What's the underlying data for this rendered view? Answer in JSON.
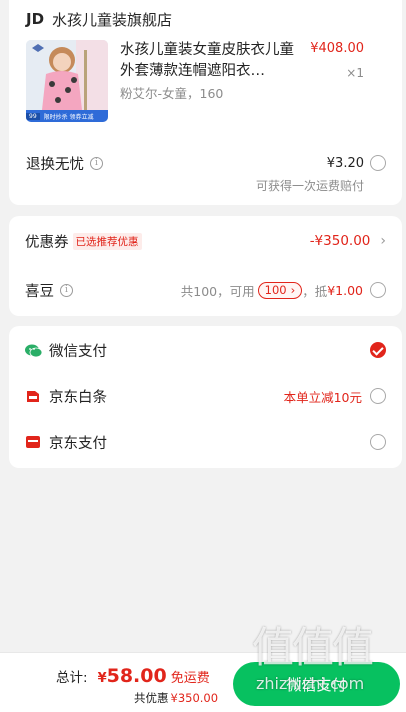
{
  "store": {
    "brand": "JD",
    "name": "水孩儿童装旗舰店"
  },
  "product": {
    "title": "水孩儿童装女童皮肤衣儿童外套薄款连帽遮阳衣…",
    "spec": "粉艾尔-女童，160",
    "price": "¥408.00",
    "qty": "×1",
    "thumb_badge": "99",
    "thumb_banner": "限时抄杀 领券立减"
  },
  "return_service": {
    "label": "退换无忧",
    "price": "¥3.20",
    "note": "可获得一次运费赔付"
  },
  "coupon": {
    "label": "优惠券",
    "tag": "已选推荐优惠",
    "amount": "-¥350.00"
  },
  "jingdou": {
    "label": "喜豆",
    "total": "共100，可用",
    "pill": "100",
    "arrow": "›",
    "deduct_prefix": "，抵",
    "deduct_amount": "¥1.00"
  },
  "payment": [
    {
      "label": "微信支付",
      "icon": "wechat-pay-icon",
      "selected": true,
      "promo": ""
    },
    {
      "label": "京东白条",
      "icon": "jd-baitiao-icon",
      "selected": false,
      "promo": "本单立减10元"
    },
    {
      "label": "京东支付",
      "icon": "jd-pay-icon",
      "selected": false,
      "promo": ""
    }
  ],
  "footer": {
    "total_label": "总计:",
    "currency": "¥",
    "total_amount": "58.00",
    "shipping": "免运费",
    "discount_label": "共优惠",
    "discount_amount": "¥350.00",
    "pay_button": "微信支付"
  },
  "watermark": {
    "text": "值值值",
    "sub": "zhizhizhi.com"
  },
  "colors": {
    "accent": "#e1251b",
    "wechat": "#2aae67",
    "pay_button": "#07c160"
  }
}
